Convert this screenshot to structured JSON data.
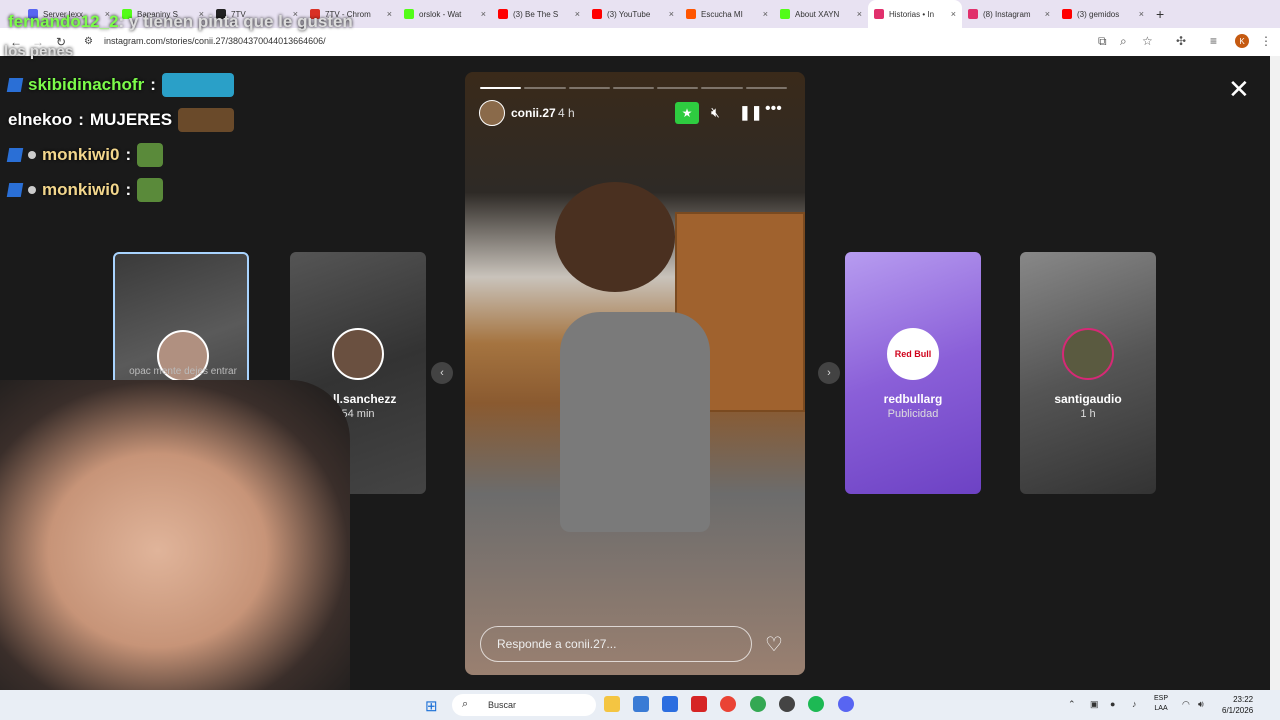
{
  "browser": {
    "tabs": [
      {
        "label": "Server lexx",
        "color": "#5865f2"
      },
      {
        "label": "Bananiny S",
        "color": "#53fc18"
      },
      {
        "label": "7TV",
        "color": "#222222"
      },
      {
        "label": "7TV - Chrom",
        "color": "#d93025"
      },
      {
        "label": "orslok - Wat",
        "color": "#53fc18"
      },
      {
        "label": "(3) Be The S",
        "color": "#ff0000"
      },
      {
        "label": "(3) YouTube",
        "color": "#ff0000"
      },
      {
        "label": "Escucha MI",
        "color": "#ff5500"
      },
      {
        "label": "About XAYN",
        "color": "#53fc18"
      },
      {
        "label": "Historias • In",
        "color": "#e1306c"
      },
      {
        "label": "(8) Instagram",
        "color": "#e1306c"
      },
      {
        "label": "(3) gemidos",
        "color": "#ff0000"
      }
    ],
    "tab_close": "×",
    "new_tab": "+",
    "url": "instagram.com/stories/conii.27/3804370044013664606/",
    "profile_initial": "K"
  },
  "chat": {
    "top_message_user": "fernando12_2",
    "top_message_text": ": y tienen pinta que le gusten",
    "top_message_text2": "los penes",
    "lines": [
      {
        "user": "skibidinachofr",
        "sep": ":",
        "text": "",
        "user_color": "#7CFC4A"
      },
      {
        "user": "elnekoo",
        "sep": ":",
        "text": "MUJERES",
        "user_color": "#ffffff"
      },
      {
        "user": "monkiwi0",
        "sep": ":",
        "text": "",
        "user_color": "#f2d68c"
      },
      {
        "user": "monkiwi0",
        "sep": ":",
        "text": "",
        "user_color": "#f2d68c"
      }
    ]
  },
  "stories": {
    "left_cards": [
      {
        "name": "",
        "time": "",
        "caption": "opac mente dejes entrar"
      },
      {
        "name": "vall.sanchezz",
        "time": "54 min"
      }
    ],
    "right_cards": [
      {
        "name": "redbullarg",
        "time": "Publicidad",
        "logo": "Red Bull"
      },
      {
        "name": "santigaudio",
        "time": "1 h"
      }
    ],
    "prev_arrow": "‹",
    "next_arrow": "›",
    "close": "✕",
    "current": {
      "username": "conii.27",
      "time": "4 h",
      "progress_segments": 7,
      "active_segment": 1,
      "reply_placeholder": "Responde a conii.27...",
      "icons": [
        "star-icon",
        "mute-icon",
        "pause-icon",
        "more-icon"
      ]
    }
  },
  "taskbar": {
    "search_label": "Buscar",
    "lang_line1": "ESP",
    "lang_line2": "LAA",
    "time": "23:22",
    "date": "6/1/2026"
  }
}
